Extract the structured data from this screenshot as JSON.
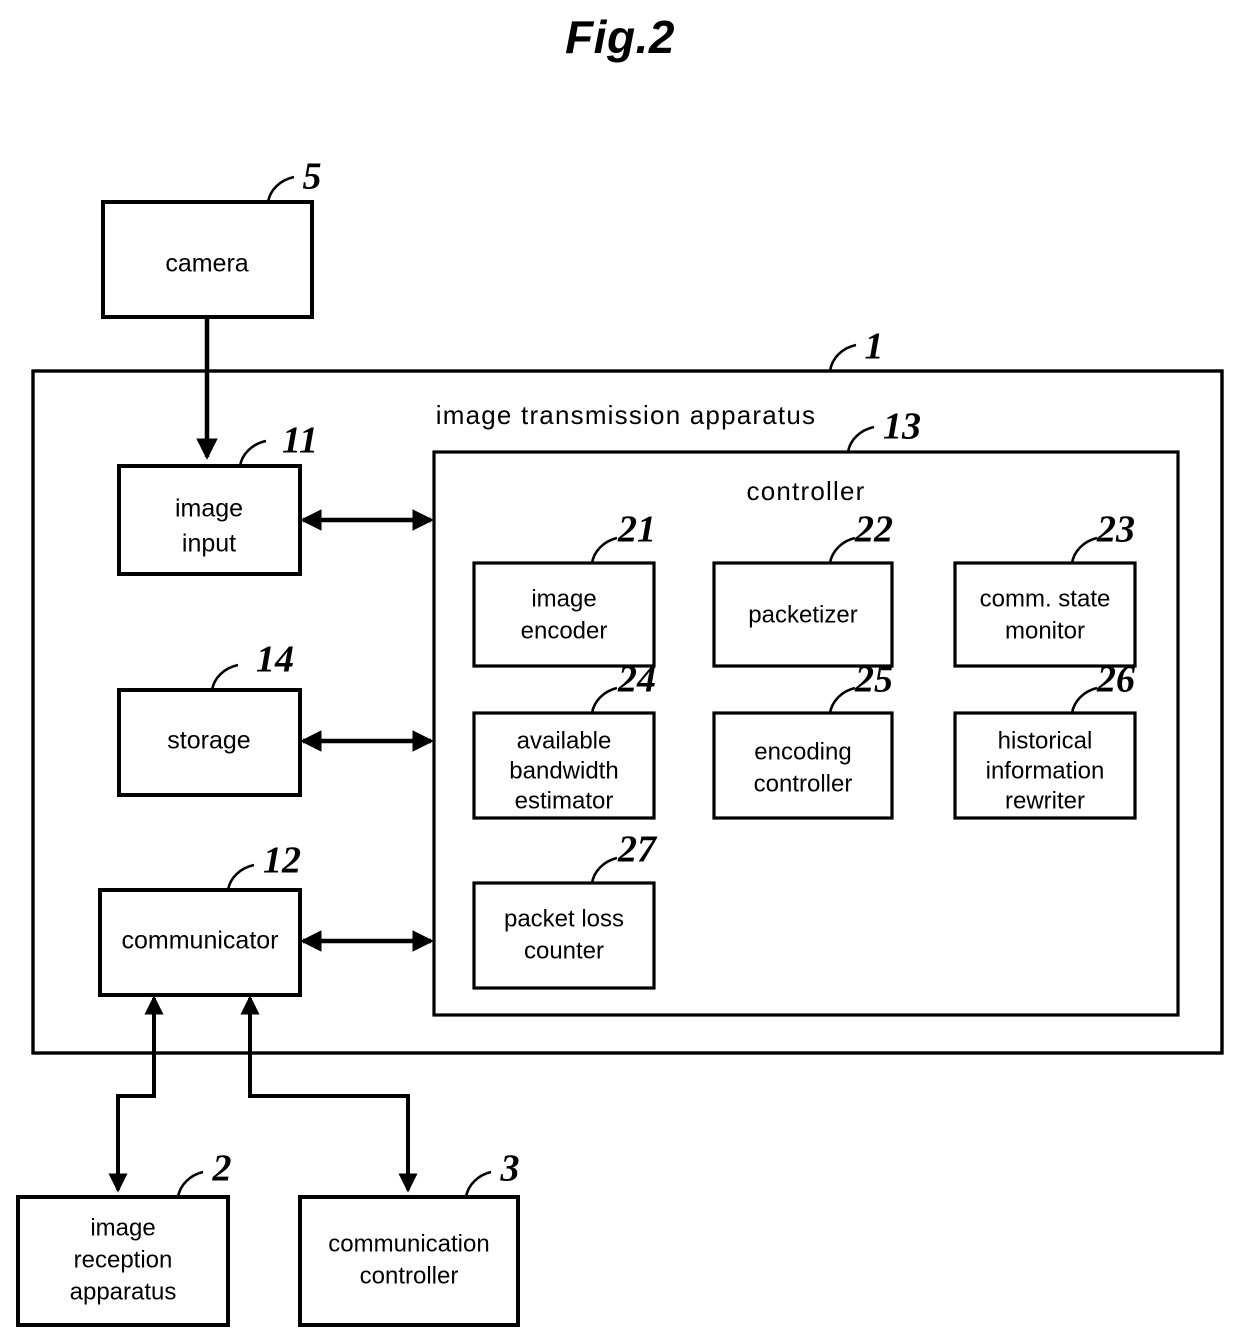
{
  "figure": {
    "title": "Fig.2"
  },
  "outer": {
    "label": "image transmission apparatus",
    "ref": "1"
  },
  "controller": {
    "label": "controller",
    "ref": "13"
  },
  "external_blocks": [
    {
      "id": "camera",
      "label": "camera",
      "ref": "5"
    },
    {
      "id": "image-reception-apparatus",
      "label_line1": "image",
      "label_line2": "reception",
      "label_line3": "apparatus",
      "ref": "2"
    },
    {
      "id": "communication-controller",
      "label_line1": "communication",
      "label_line2": "controller",
      "ref": "3"
    }
  ],
  "apparatus_blocks": [
    {
      "id": "image-input",
      "label_line1": "image",
      "label_line2": "input",
      "ref": "11"
    },
    {
      "id": "storage",
      "label_line1": "storage",
      "label_line2": "",
      "ref": "14"
    },
    {
      "id": "communicator",
      "label_line1": "communicator",
      "label_line2": "",
      "ref": "12"
    }
  ],
  "controller_blocks": [
    {
      "id": "image-encoder",
      "label_line1": "image",
      "label_line2": "encoder",
      "label_line3": "",
      "ref": "21"
    },
    {
      "id": "packetizer",
      "label_line1": "packetizer",
      "label_line2": "",
      "label_line3": "",
      "ref": "22"
    },
    {
      "id": "comm-state-monitor",
      "label_line1": "comm. state",
      "label_line2": "monitor",
      "label_line3": "",
      "ref": "23"
    },
    {
      "id": "available-bandwidth-estimator",
      "label_line1": "available",
      "label_line2": "bandwidth",
      "label_line3": "estimator",
      "ref": "24"
    },
    {
      "id": "encoding-controller",
      "label_line1": "encoding",
      "label_line2": "controller",
      "label_line3": "",
      "ref": "25"
    },
    {
      "id": "historical-information-rewriter",
      "label_line1": "historical",
      "label_line2": "information",
      "label_line3": "rewriter",
      "ref": "26"
    },
    {
      "id": "packet-loss-counter",
      "label_line1": "packet loss",
      "label_line2": "counter",
      "label_line3": "",
      "ref": "27"
    }
  ],
  "colors": {
    "stroke": "#000000",
    "background": "#ffffff"
  }
}
